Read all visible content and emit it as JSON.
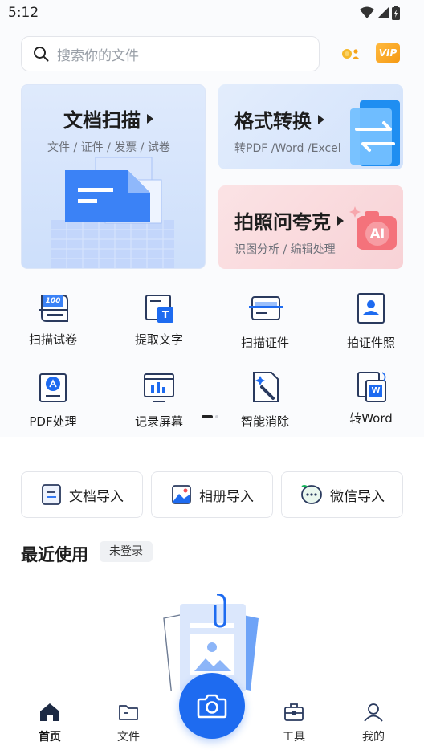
{
  "status_bar": {
    "time": "5:12"
  },
  "search": {
    "placeholder": "搜索你的文件"
  },
  "header_badges": {
    "vip": "VIP"
  },
  "cards": {
    "scan": {
      "title": "文档扫描",
      "subtitle": "文件 / 证件 / 发票 / 试卷"
    },
    "format": {
      "title": "格式转换",
      "subtitle": "转PDF /Word /Excel"
    },
    "ai": {
      "title": "拍照问夸克",
      "subtitle": "识图分析 / 编辑处理",
      "badge": "AI"
    }
  },
  "tools": [
    {
      "label": "扫描试卷",
      "icon": "exam-scan-icon",
      "icon_text": "100"
    },
    {
      "label": "提取文字",
      "icon": "extract-text-icon",
      "icon_text": "T"
    },
    {
      "label": "扫描证件",
      "icon": "id-card-scan-icon"
    },
    {
      "label": "拍证件照",
      "icon": "id-photo-icon"
    },
    {
      "label": "PDF处理",
      "icon": "pdf-icon"
    },
    {
      "label": "记录屏幕",
      "icon": "screen-record-icon"
    },
    {
      "label": "智能消除",
      "icon": "magic-erase-icon"
    },
    {
      "label": "转Word",
      "icon": "to-word-icon",
      "icon_text": "W"
    }
  ],
  "imports": [
    {
      "label": "文档导入",
      "icon": "document-import-icon"
    },
    {
      "label": "相册导入",
      "icon": "album-import-icon"
    },
    {
      "label": "微信导入",
      "icon": "wechat-import-icon"
    }
  ],
  "recent": {
    "title": "最近使用",
    "badge": "未登录"
  },
  "tabbar": {
    "tabs": [
      {
        "label": "首页",
        "icon": "home-icon",
        "active": true
      },
      {
        "label": "文件",
        "icon": "folder-icon",
        "active": false
      },
      {
        "label": "工具",
        "icon": "toolbox-icon",
        "active": false
      },
      {
        "label": "我的",
        "icon": "profile-icon",
        "active": false
      }
    ],
    "center_button_icon": "camera-icon"
  },
  "colors": {
    "accent": "#1e6bf0",
    "ai_red": "#f0505a",
    "vip_gold": "#f5a31b"
  }
}
